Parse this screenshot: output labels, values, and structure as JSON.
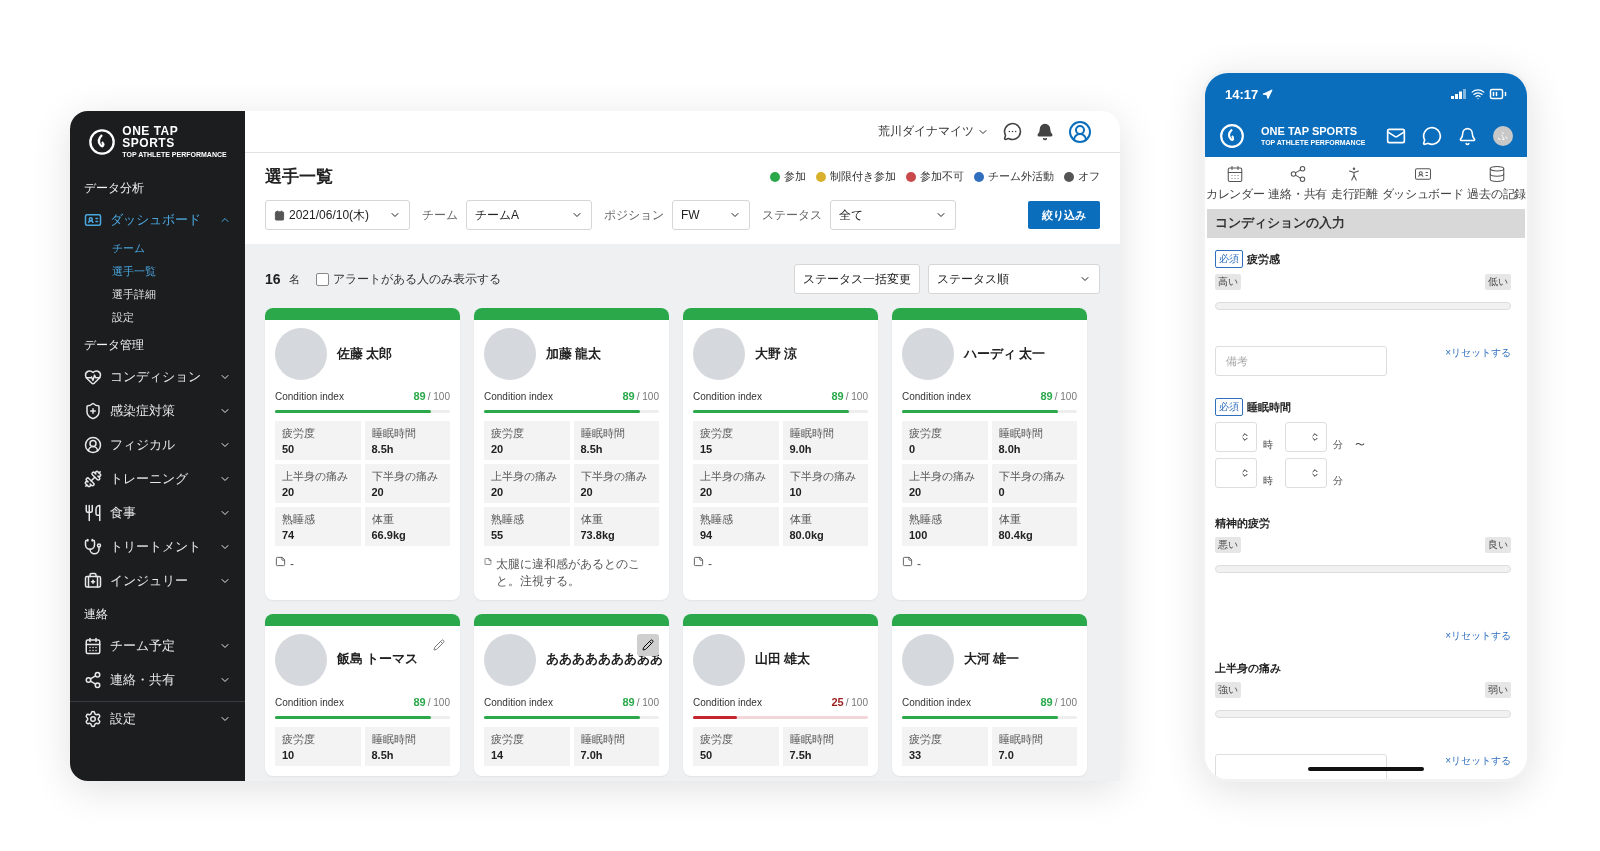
{
  "sidebar": {
    "logo": {
      "line1": "ONE TAP",
      "line2": "SPORTS",
      "tagline": "TOP ATHLETE PERFORMANCE"
    },
    "sections": [
      {
        "heading": "データ分析",
        "items": [
          {
            "label": "ダッシュボード",
            "selected": true,
            "expanded": true,
            "children": [
              {
                "label": "チーム",
                "selected": true
              },
              {
                "label": "選手一覧",
                "selected": true
              },
              {
                "label": "選手詳細",
                "selected": false
              },
              {
                "label": "設定",
                "selected": false
              }
            ]
          }
        ]
      },
      {
        "heading": "データ管理",
        "items": [
          {
            "label": "コンディション",
            "selected": false,
            "expanded": false
          },
          {
            "label": "感染症対策",
            "selected": false,
            "expanded": false
          },
          {
            "label": "フィジカル",
            "selected": false,
            "expanded": false
          },
          {
            "label": "トレーニング",
            "selected": false,
            "expanded": false
          },
          {
            "label": "食事",
            "selected": false,
            "expanded": false
          },
          {
            "label": "トリートメント",
            "selected": false,
            "expanded": false
          },
          {
            "label": "インジュリー",
            "selected": false,
            "expanded": false
          }
        ]
      },
      {
        "heading": "連絡",
        "items": [
          {
            "label": "チーム予定",
            "selected": false,
            "expanded": false
          },
          {
            "label": "連絡・共有",
            "selected": false,
            "expanded": false
          }
        ]
      }
    ],
    "footer_item": {
      "label": "設定",
      "selected": false,
      "expanded": false
    }
  },
  "header": {
    "team": "荒川ダイナマイツ"
  },
  "page": {
    "title": "選手一覧",
    "legend": [
      {
        "label": "参加",
        "color": "#2aa84a"
      },
      {
        "label": "制限付き参加",
        "color": "#d8b02c"
      },
      {
        "label": "参加不可",
        "color": "#c9484b"
      },
      {
        "label": "チーム外活動",
        "color": "#2f6fbe"
      },
      {
        "label": "オフ",
        "color": "#555555"
      }
    ],
    "filters": {
      "date": "2021/06/10(木)",
      "fields": [
        {
          "label": "チーム",
          "value": "チームA"
        },
        {
          "label": "ポジション",
          "value": "FW"
        },
        {
          "label": "ステータス",
          "value": "全て"
        }
      ],
      "apply": "絞り込み"
    }
  },
  "toolbar": {
    "count": "16",
    "count_unit": "名",
    "alert_only": {
      "label": "アラートがある人のみ表示する",
      "checked": false
    },
    "bulk_button": "ステータス一括変更",
    "sort": "ステータス順"
  },
  "players": [
    {
      "name": "佐藤 太郎",
      "color": "#2aa84a",
      "index_label": "Condition index",
      "score": "89",
      "max": "/ 100",
      "level": 0.89,
      "alert": false,
      "editable": false,
      "edit_hovered": false,
      "stats": [
        {
          "label": "疲労度",
          "value": "50"
        },
        {
          "label": "睡眠時間",
          "value": "8.5h"
        },
        {
          "label": "上半身の痛み",
          "value": "20"
        },
        {
          "label": "下半身の痛み",
          "value": "20"
        },
        {
          "label": "熟睡感",
          "value": "74"
        },
        {
          "label": "体重",
          "value": "66.9kg"
        }
      ],
      "note": "-"
    },
    {
      "name": "加藤 龍太",
      "color": "#2aa84a",
      "index_label": "Condition index",
      "score": "89",
      "max": "/ 100",
      "level": 0.89,
      "alert": false,
      "editable": false,
      "edit_hovered": false,
      "stats": [
        {
          "label": "疲労度",
          "value": "20"
        },
        {
          "label": "睡眠時間",
          "value": "8.5h"
        },
        {
          "label": "上半身の痛み",
          "value": "20"
        },
        {
          "label": "下半身の痛み",
          "value": "20"
        },
        {
          "label": "熟睡感",
          "value": "55"
        },
        {
          "label": "体重",
          "value": "73.8kg"
        }
      ],
      "note": "太腿に違和感があるとのこと。注視する。"
    },
    {
      "name": "大野 涼",
      "color": "#2aa84a",
      "index_label": "Condition index",
      "score": "89",
      "max": "/ 100",
      "level": 0.89,
      "alert": false,
      "editable": false,
      "edit_hovered": false,
      "stats": [
        {
          "label": "疲労度",
          "value": "15"
        },
        {
          "label": "睡眠時間",
          "value": "9.0h"
        },
        {
          "label": "上半身の痛み",
          "value": "20"
        },
        {
          "label": "下半身の痛み",
          "value": "10"
        },
        {
          "label": "熟睡感",
          "value": "94"
        },
        {
          "label": "体重",
          "value": "80.0kg"
        }
      ],
      "note": "-"
    },
    {
      "name": "ハーディ 太一",
      "color": "#2aa84a",
      "index_label": "Condition index",
      "score": "89",
      "max": "/ 100",
      "level": 0.89,
      "alert": false,
      "editable": false,
      "edit_hovered": false,
      "stats": [
        {
          "label": "疲労度",
          "value": "0"
        },
        {
          "label": "睡眠時間",
          "value": "8.0h"
        },
        {
          "label": "上半身の痛み",
          "value": "20"
        },
        {
          "label": "下半身の痛み",
          "value": "0"
        },
        {
          "label": "熟睡感",
          "value": "100"
        },
        {
          "label": "体重",
          "value": "80.4kg"
        }
      ],
      "note": "-"
    },
    {
      "name": "飯島 トーマス",
      "color": "#2aa84a",
      "index_label": "Condition index",
      "score": "89",
      "max": "/ 100",
      "level": 0.89,
      "alert": false,
      "editable": true,
      "edit_hovered": false,
      "stats": [
        {
          "label": "疲労度",
          "value": "10"
        },
        {
          "label": "睡眠時間",
          "value": "8.5h"
        }
      ]
    },
    {
      "name": "あああああああああ",
      "color": "#2aa84a",
      "index_label": "Condition index",
      "score": "89",
      "max": "/ 100",
      "level": 0.89,
      "alert": false,
      "editable": true,
      "edit_hovered": true,
      "stats": [
        {
          "label": "疲労度",
          "value": "14"
        },
        {
          "label": "睡眠時間",
          "value": "7.0h"
        }
      ]
    },
    {
      "name": "山田 雄太",
      "color": "#2aa84a",
      "index_label": "Condition index",
      "score": "25",
      "max": "/ 100",
      "level": 0.25,
      "alert": true,
      "editable": false,
      "edit_hovered": false,
      "stats": [
        {
          "label": "疲労度",
          "value": "50"
        },
        {
          "label": "睡眠時間",
          "value": "7.5h"
        }
      ]
    },
    {
      "name": "大河 雄一",
      "color": "#2aa84a",
      "index_label": "Condition index",
      "score": "89",
      "max": "/ 100",
      "level": 0.89,
      "alert": false,
      "editable": false,
      "edit_hovered": false,
      "stats": [
        {
          "label": "疲労度",
          "value": "33"
        },
        {
          "label": "睡眠時間",
          "value": "7.0"
        }
      ]
    }
  ],
  "phone": {
    "time": "14:17",
    "brand": "ONE TAP SPORTS",
    "tagline": "TOP ATHLETE PERFORMANCE",
    "avatar": "ふ",
    "nav": [
      {
        "label": "カレンダー"
      },
      {
        "label": "連絡・共有"
      },
      {
        "label": "走行距離"
      },
      {
        "label": "ダッシュボード"
      },
      {
        "label": "過去の記録"
      }
    ],
    "heading": "コンディションの入力",
    "fields": [
      {
        "kind": "slider",
        "label": "疲労感",
        "required": true,
        "badge": "必須",
        "low": "高い",
        "high": "低い",
        "note_field": true,
        "note_placeholder": "備考",
        "reset": "×リセットする"
      },
      {
        "kind": "time",
        "label": "睡眠時間",
        "required": true,
        "badge": "必須",
        "rows": [
          {
            "hour_unit": "時",
            "minute_unit": "分",
            "suffix": "〜"
          },
          {
            "hour_unit": "時",
            "minute_unit": "分"
          }
        ]
      },
      {
        "kind": "slider",
        "label": "精神的疲労",
        "required": false,
        "low": "悪い",
        "high": "良い",
        "note_field": false,
        "reset": "×リセットする"
      },
      {
        "kind": "slider",
        "label": "上半身の痛み",
        "required": false,
        "low": "強い",
        "high": "弱い",
        "note_field": true,
        "reset": "×リセットする"
      }
    ]
  }
}
